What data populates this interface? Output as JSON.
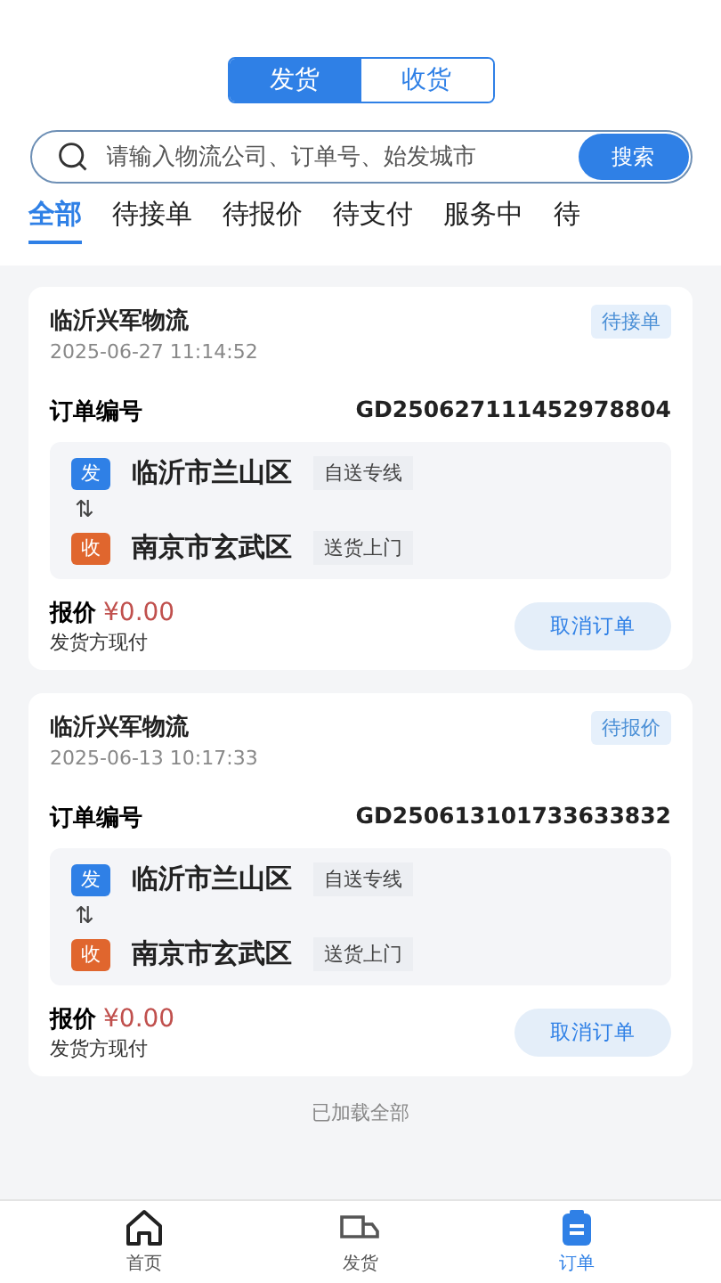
{
  "segment": [
    {
      "label": "发货",
      "selected": true
    },
    {
      "label": "收货",
      "selected": false
    }
  ],
  "search": {
    "placeholder": "请输入物流公司、订单号、始发城市",
    "button": "搜索"
  },
  "tabs": [
    {
      "label": "全部",
      "selected": true
    },
    {
      "label": "待接单",
      "selected": false
    },
    {
      "label": "待报价",
      "selected": false
    },
    {
      "label": "待支付",
      "selected": false
    },
    {
      "label": "服务中",
      "selected": false
    },
    {
      "label": "待",
      "selected": false
    }
  ],
  "orders": [
    {
      "company": "临沂兴军物流",
      "time": "2025-06-27 11:14:52",
      "status": "待接单",
      "order_label": "订单编号",
      "order_no": "GD250627111452978804",
      "from_badge": "发",
      "from_city": "临沂市兰山区",
      "from_tag": "自送专线",
      "swap": "⇅",
      "to_badge": "收",
      "to_city": "南京市玄武区",
      "to_tag": "送货上门",
      "price_label": "报价",
      "price": "¥0.00",
      "payment": "发货方现付",
      "action": "取消订单"
    },
    {
      "company": "临沂兴军物流",
      "time": "2025-06-13 10:17:33",
      "status": "待报价",
      "order_label": "订单编号",
      "order_no": "GD250613101733633832",
      "from_badge": "发",
      "from_city": "临沂市兰山区",
      "from_tag": "自送专线",
      "swap": "⇅",
      "to_badge": "收",
      "to_city": "南京市玄武区",
      "to_tag": "送货上门",
      "price_label": "报价",
      "price": "¥0.00",
      "payment": "发货方现付",
      "action": "取消订单"
    }
  ],
  "footer": "已加载全部",
  "nav": [
    {
      "label": "首页",
      "kind": "home",
      "selected": false
    },
    {
      "label": "发货",
      "kind": "truck",
      "selected": false
    },
    {
      "label": "订单",
      "kind": "orders",
      "selected": true
    }
  ]
}
